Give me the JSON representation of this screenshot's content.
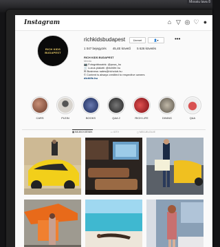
{
  "app": {
    "name": "Instagram"
  },
  "corner_tag": "Mossiu tava 8",
  "profile": {
    "username": "richkidsbudapest",
    "follow_label": "Üzenet",
    "avatar_text": "RICH KIDS BUDAPEST",
    "posts": "1 047 bejegyzés",
    "followers": "45,4E követő",
    "following": "5 626 követés",
    "display_name": "RICH KIDS BUDAPEST",
    "category": "Média",
    "bio_lines": [
      "📷 Fotográfusaink: @pusa_hu",
      "🛒 Luxus plakátt: @richlife.hu",
      "✉ Business: sales@richclub.hu",
      "© Content is always credited to respective owners"
    ],
    "website": "dichlife.hu"
  },
  "highlights": [
    {
      "label": "CARS",
      "color": "#8a5a4a"
    },
    {
      "label": "PLEIN",
      "color": "#c8c4be"
    },
    {
      "label": "BOOKS",
      "color": "#2a3a6a"
    },
    {
      "label": "Q&A 2",
      "color": "#3a3a3a"
    },
    {
      "label": "RICH LIFE",
      "color": "#b8222a"
    },
    {
      "label": "DINING",
      "color": "#8a8478"
    },
    {
      "label": "Q&A",
      "color": "#aa2a2a"
    }
  ],
  "tabs": [
    "BEJEGYZÉSEK",
    "IGTV",
    "MEGJELÖLVE"
  ],
  "active_tab": 0
}
